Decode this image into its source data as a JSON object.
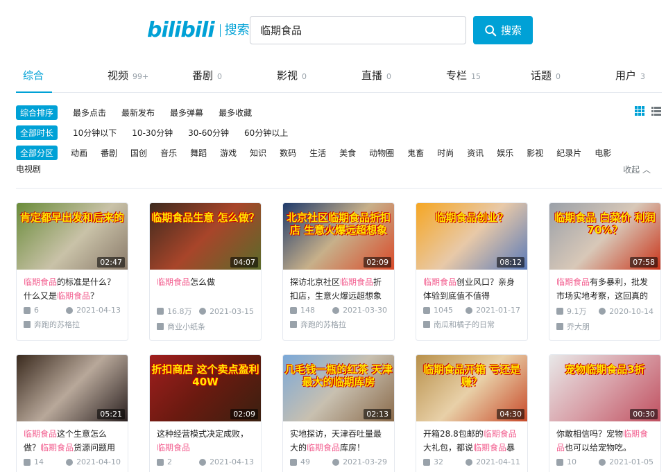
{
  "header": {
    "logo_text": "bilibili",
    "logo_sub": "搜索",
    "search_value": "临期食品",
    "search_button": "搜索"
  },
  "tabs": [
    {
      "label": "综合",
      "count": ""
    },
    {
      "label": "视频",
      "count": "99+"
    },
    {
      "label": "番剧",
      "count": "0"
    },
    {
      "label": "影视",
      "count": "0"
    },
    {
      "label": "直播",
      "count": "0"
    },
    {
      "label": "专栏",
      "count": "15"
    },
    {
      "label": "话题",
      "count": "0"
    },
    {
      "label": "用户",
      "count": "3"
    }
  ],
  "filters": {
    "order": [
      "综合排序",
      "最多点击",
      "最新发布",
      "最多弹幕",
      "最多收藏"
    ],
    "duration": [
      "全部时长",
      "10分钟以下",
      "10-30分钟",
      "30-60分钟",
      "60分钟以上"
    ],
    "zone": [
      "全部分区",
      "动画",
      "番剧",
      "国创",
      "音乐",
      "舞蹈",
      "游戏",
      "知识",
      "数码",
      "生活",
      "美食",
      "动物圈",
      "鬼畜",
      "时尚",
      "资讯",
      "娱乐",
      "影视",
      "纪录片",
      "电影",
      "电视剧"
    ],
    "collapse": "收起"
  },
  "colors": {
    "accent": "#00a1d6",
    "highlight": "#f25d8e"
  },
  "videos": [
    {
      "thumb_caption": "肯定都早出发和后来的",
      "duration": "02:47",
      "title_parts": [
        {
          "t": "临期食品",
          "hl": true
        },
        {
          "t": "的标准是什么？什么又是",
          "hl": false
        },
        {
          "t": "临期食品",
          "hl": true
        },
        {
          "t": "？",
          "hl": false
        }
      ],
      "views": "6",
      "date": "2021-04-13",
      "uploader": "奔跑的苏格拉"
    },
    {
      "thumb_caption": "临期食品生意 怎么做？",
      "duration": "04:07",
      "title_parts": [
        {
          "t": "临期食品",
          "hl": true
        },
        {
          "t": "怎么做",
          "hl": false
        }
      ],
      "views": "16.8万",
      "date": "2021-03-15",
      "uploader": "商业小纸条"
    },
    {
      "thumb_caption": "北京社区临期食品折扣店 生意火爆远超想象",
      "duration": "02:09",
      "title_parts": [
        {
          "t": "探访北京社区",
          "hl": false
        },
        {
          "t": "临期食品",
          "hl": true
        },
        {
          "t": "折扣店，生意火爆远超想象",
          "hl": false
        }
      ],
      "views": "148",
      "date": "2021-03-30",
      "uploader": "奔跑的苏格拉"
    },
    {
      "thumb_caption": "临期食品创业？",
      "duration": "08:12",
      "title_parts": [
        {
          "t": "临期食品",
          "hl": true
        },
        {
          "t": "创业风口？亲身体验到底值不值得",
          "hl": false
        }
      ],
      "views": "1045",
      "date": "2021-01-17",
      "uploader": "南瓜和橘子的日常"
    },
    {
      "thumb_caption": "临期食品 白菜价 利润70%？",
      "duration": "07:58",
      "title_parts": [
        {
          "t": "临期食品",
          "hl": true
        },
        {
          "t": "有多暴利，批发市场实地考察，这回真的刷新",
          "hl": false
        }
      ],
      "views": "9.1万",
      "date": "2020-10-14",
      "uploader": "乔大朋"
    },
    {
      "thumb_caption": "",
      "duration": "05:21",
      "title_parts": [
        {
          "t": "临期食品",
          "hl": true
        },
        {
          "t": "这个生意怎么做？",
          "hl": false
        },
        {
          "t": "临期食品",
          "hl": true
        },
        {
          "t": "货源问题用这个方",
          "hl": false
        }
      ],
      "views": "14",
      "date": "2021-04-10",
      "uploader": ""
    },
    {
      "thumb_caption": "折扣商店 这个卖点盈利40W",
      "duration": "02:09",
      "title_parts": [
        {
          "t": "这种经营模式决定成败，",
          "hl": false
        },
        {
          "t": "临期食品",
          "hl": true
        }
      ],
      "views": "2",
      "date": "2021-04-13",
      "uploader": ""
    },
    {
      "thumb_caption": "几毛钱一瓶的红茶 天津最大的临期库房",
      "duration": "02:13",
      "title_parts": [
        {
          "t": "实地探访，天津吞吐量最大的",
          "hl": false
        },
        {
          "t": "临期食品",
          "hl": true
        },
        {
          "t": "库房！",
          "hl": false
        }
      ],
      "views": "49",
      "date": "2021-03-29",
      "uploader": ""
    },
    {
      "thumb_caption": "临期食品开箱 亏还是赚？",
      "duration": "04:30",
      "title_parts": [
        {
          "t": "开箱28.8包邮的",
          "hl": false
        },
        {
          "t": "临期食品",
          "hl": true
        },
        {
          "t": "大礼包，都说",
          "hl": false
        },
        {
          "t": "临期食品",
          "hl": true
        },
        {
          "t": "暴利，",
          "hl": false
        }
      ],
      "views": "32",
      "date": "2021-04-11",
      "uploader": ""
    },
    {
      "thumb_caption": "宠物临期食品3折",
      "duration": "00:30",
      "title_parts": [
        {
          "t": "你敢相信吗？宠物",
          "hl": false
        },
        {
          "t": "临期食品",
          "hl": true
        },
        {
          "t": "也可以给宠物吃。",
          "hl": false
        }
      ],
      "views": "10",
      "date": "2021-01-05",
      "uploader": ""
    }
  ]
}
